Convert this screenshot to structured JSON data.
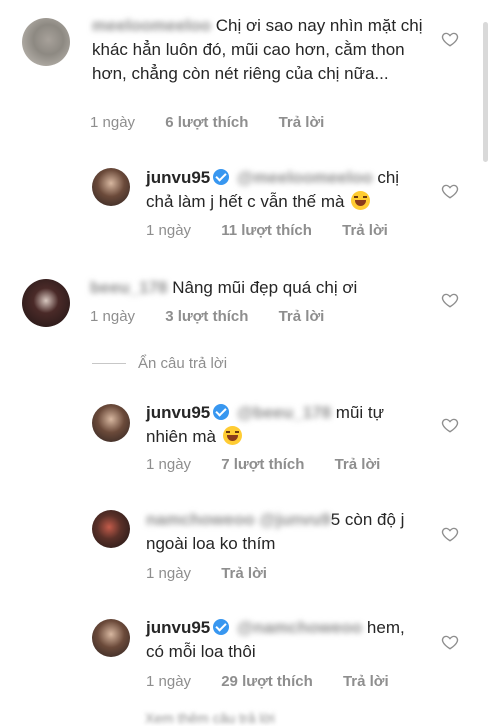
{
  "comments": [
    {
      "id": "c1",
      "username_blurred": "meeloomeeloo",
      "text": "Chị ơi sao nay nhìn mặt chị khác hẳn luôn đó, mũi cao hơn, cằm thon hơn, chẳng còn nét riêng của chị nữa...",
      "time": "1 ngày",
      "likes": "6 lượt thích",
      "reply": "Trả lời"
    },
    {
      "id": "r1",
      "username": "junvu95",
      "mention_blurred": "@meeloomeeloo",
      "text": "chị chả làm j hết c vẫn thế mà",
      "emoji": "rolling-on-floor-laughing",
      "time": "1 ngày",
      "likes": "11 lượt thích",
      "reply": "Trả lời"
    },
    {
      "id": "c2",
      "username_blurred": "beeu_178",
      "text": "Nâng mũi đẹp quá chị ơi",
      "time": "1 ngày",
      "likes": "3 lượt thích",
      "reply": "Trả lời"
    },
    {
      "id": "r2",
      "username": "junvu95",
      "mention_blurred": "@beeu_178",
      "text": "mũi tự nhiên mà",
      "emoji": "tears-of-joy",
      "time": "1 ngày",
      "likes": "7 lượt thích",
      "reply": "Trả lời"
    },
    {
      "id": "r3",
      "username_blurred": "namchoweoo",
      "mention_blurred": "@junvu9",
      "text_tail": "5 còn độ j ngoài loa ko thím",
      "time": "1 ngày",
      "reply": "Trả lời"
    },
    {
      "id": "r4",
      "username": "junvu95",
      "mention_blurred": "@namchoweoo",
      "text": "hem, có mỗi loa thôi",
      "time": "1 ngày",
      "likes": "29 lượt thích",
      "reply": "Trả lời"
    }
  ],
  "hide_replies": "Ẩn câu trả lời",
  "cutoff_text": "Xem thêm câu trả lời",
  "colors": {
    "text": "#262626",
    "muted": "#8e8e8e",
    "verified": "#3897f0"
  },
  "icons": [
    "heart-outline-icon",
    "verified-badge-icon"
  ]
}
